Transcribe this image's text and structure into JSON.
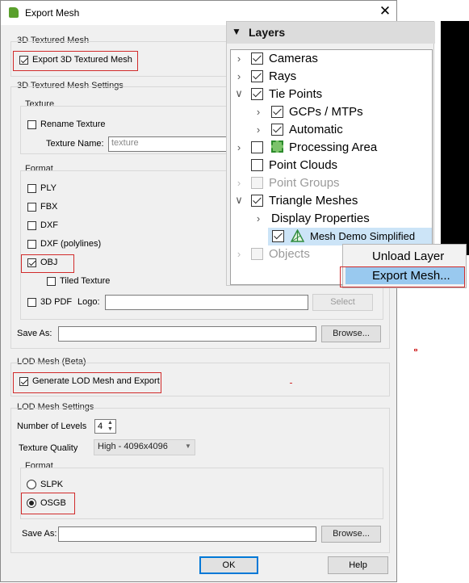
{
  "window": {
    "title": "Export Mesh",
    "close_glyph": "✕"
  },
  "textured": {
    "section_label": "3D Textured Mesh",
    "export_label": "Export 3D Textured Mesh",
    "export_checked": true
  },
  "settings": {
    "section_label": "3D Textured Mesh Settings",
    "texture": {
      "group_label": "Texture",
      "rename_label": "Rename Texture",
      "rename_checked": false,
      "name_label": "Texture Name:",
      "name_placeholder": "texture"
    },
    "format": {
      "group_label": "Format",
      "ply": "PLY",
      "fbx": "FBX",
      "dxf": "DXF",
      "dxf_polylines": "DXF (polylines)",
      "obj": "OBJ",
      "tiled": "Tiled Texture",
      "pdf": "3D PDF",
      "logo_label": "Logo:",
      "select_button": "Select"
    },
    "save_as_label": "Save As:",
    "browse_button": "Browse..."
  },
  "lod": {
    "section_label": "LOD Mesh (Beta)",
    "generate_label": "Generate LOD Mesh and Export",
    "generate_checked": true,
    "settings_label": "LOD Mesh Settings",
    "levels_label": "Number of Levels",
    "levels_value": "4",
    "quality_label": "Texture Quality",
    "quality_value": "High - 4096x4096",
    "format_label": "Format",
    "slpk": "SLPK",
    "osgb": "OSGB",
    "selected_format": "OSGB",
    "save_as_label": "Save As:",
    "browse_button": "Browse..."
  },
  "buttons": {
    "ok": "OK",
    "help": "Help"
  },
  "layers": {
    "title": "Layers",
    "items": [
      {
        "label": "Cameras",
        "checked": true
      },
      {
        "label": "Rays",
        "checked": true
      },
      {
        "label": "Tie Points",
        "checked": true,
        "expanded": true
      },
      {
        "label": "GCPs / MTPs",
        "checked": true
      },
      {
        "label": "Automatic",
        "checked": true
      },
      {
        "label": "Processing Area",
        "checked": false
      },
      {
        "label": "Point Clouds",
        "checked": false
      },
      {
        "label": "Point Groups",
        "checked": false,
        "disabled": true
      },
      {
        "label": "Triangle Meshes",
        "checked": true,
        "expanded": true
      },
      {
        "label": "Display Properties"
      },
      {
        "label": "Mesh Demo Simplified",
        "checked": true,
        "selected": true
      },
      {
        "label": "Objects",
        "checked": false,
        "disabled": true
      }
    ]
  },
  "context_menu": {
    "items": [
      "Unload Layer",
      "Export Mesh..."
    ],
    "highlighted": "Export Mesh..."
  },
  "colors": {
    "highlight": "#99c9ef",
    "annotation_red": "#d12b2b",
    "app_green": "#5aa02c"
  },
  "icons": [
    "app-icon",
    "close-icon",
    "triangle-down-icon",
    "chevron-right-icon",
    "chevron-down-icon",
    "mesh-icon",
    "processing-area-icon",
    "spin-up-icon",
    "spin-down-icon",
    "combo-arrow-icon"
  ]
}
